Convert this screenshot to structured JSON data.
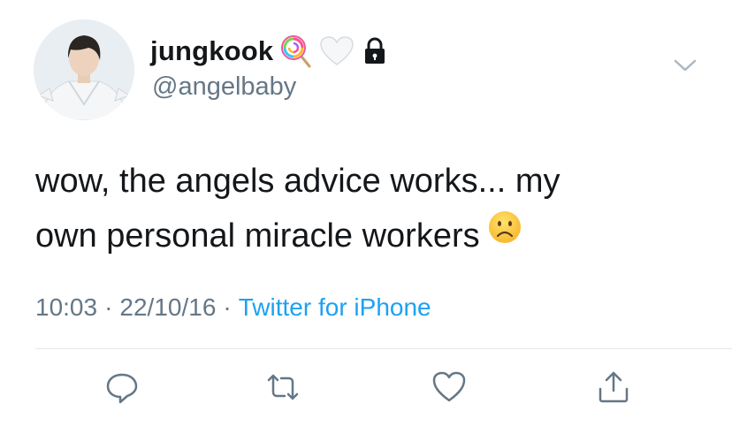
{
  "user": {
    "display_name": "jungkook",
    "handle": "@angelbaby",
    "name_emojis": [
      "lollipop-emoji",
      "white-heart-emoji",
      "lock-icon"
    ]
  },
  "tweet": {
    "line1": "wow, the angels advice works... my",
    "line2": "own personal miracle workers",
    "trailing_emoji": "frowning-face-emoji"
  },
  "meta": {
    "time": "10:03",
    "separator": "·",
    "date": "22/10/16",
    "source": "Twitter for iPhone"
  },
  "actions": [
    "reply-icon",
    "retweet-icon",
    "like-icon",
    "share-icon"
  ],
  "colors": {
    "text": "#14171a",
    "secondary": "#657786",
    "link": "#1da1f2",
    "divider": "#e1e8ed",
    "icon": "#657786"
  }
}
